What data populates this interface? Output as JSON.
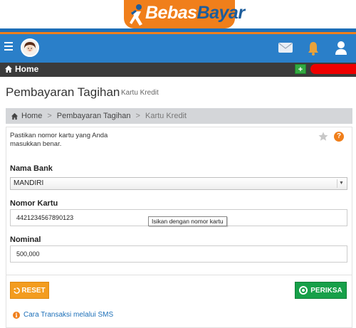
{
  "app": {
    "logo_bebas": "Bebas",
    "logo_bayar": "Bayar"
  },
  "colors": {
    "brand_orange": "#f07f1b",
    "brand_blue": "#2a7fc9",
    "reset_orange": "#f39c1f",
    "periksa_green": "#17a049"
  },
  "nav": {
    "home_label": "Home",
    "add_label": "+",
    "icons": [
      "hamburger-icon",
      "avatar",
      "mail-icon",
      "bell-icon",
      "user-icon"
    ]
  },
  "page": {
    "title": "Pembayaran Tagihan",
    "subtitle": "Kartu Kredit"
  },
  "breadcrumb": {
    "home": "Home",
    "sep1": ">",
    "level1": "Pembayaran Tagihan",
    "sep2": ">",
    "current": "Kartu Kredit"
  },
  "panel": {
    "info_text": "Pastikan nomor kartu yang Anda masukkan benar.",
    "help_label": "?"
  },
  "form": {
    "bank_label": "Nama Bank",
    "bank_value": "MANDIRI",
    "card_label": "Nomor Kartu",
    "card_value": "4421234567890123",
    "card_tooltip": "Isikan dengan nomor kartu",
    "nominal_label": "Nominal",
    "nominal_value": "500,000"
  },
  "buttons": {
    "reset": "RESET",
    "periksa": "PERIKSA"
  },
  "footer": {
    "sms_link": "Cara Transaksi melalui SMS",
    "info_glyph": "i"
  }
}
